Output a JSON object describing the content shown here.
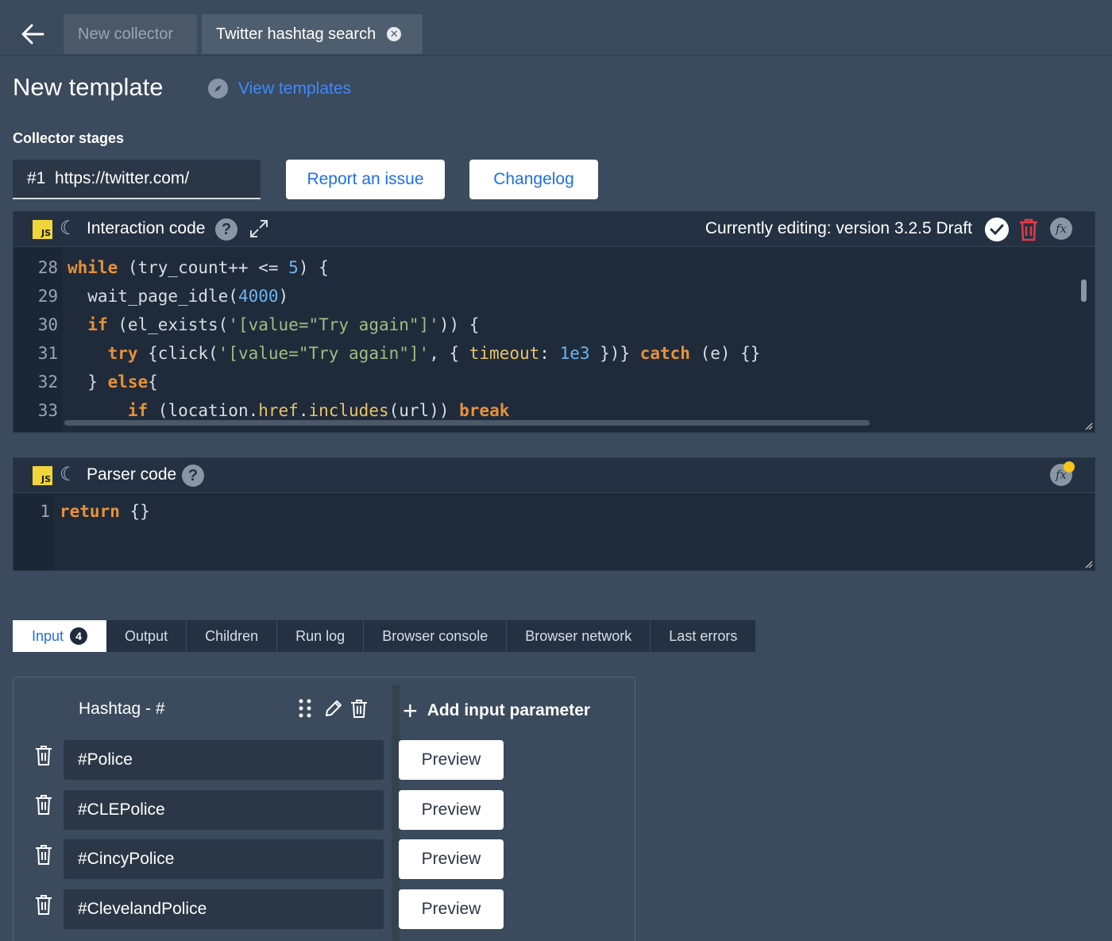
{
  "tabs": {
    "new_collector": "New collector",
    "active": "Twitter hashtag search"
  },
  "header": {
    "title": "New template",
    "view_templates": "View templates"
  },
  "stages": {
    "label": "Collector stages",
    "selected": "#1  https://twitter.com/",
    "report_issue": "Report an issue",
    "changelog": "Changelog"
  },
  "interaction": {
    "title": "Interaction code",
    "editing": "Currently editing: version 3.2.5 Draft",
    "lines": [
      {
        "n": "28",
        "code": "while (try_count++ <= 5) {"
      },
      {
        "n": "29",
        "code": "  wait_page_idle(4000)"
      },
      {
        "n": "30",
        "code": "  if (el_exists('[value=\"Try again\"]')) {"
      },
      {
        "n": "31",
        "code": "    try {click('[value=\"Try again\"]', { timeout: 1e3 })} catch (e) {}"
      },
      {
        "n": "32",
        "code": "  } else{"
      },
      {
        "n": "33",
        "code": "      if (location.href.includes(url)) break"
      }
    ]
  },
  "parser": {
    "title": "Parser code",
    "lines": [
      {
        "n": "1",
        "code": "return {}"
      }
    ]
  },
  "bottom_tabs": {
    "input": "Input",
    "input_count": "4",
    "output": "Output",
    "children": "Children",
    "run_log": "Run log",
    "browser_console": "Browser console",
    "browser_network": "Browser network",
    "last_errors": "Last errors"
  },
  "input_table": {
    "column": "Hashtag - #",
    "add_param": "Add input parameter",
    "preview_label": "Preview",
    "rows": [
      "#Police",
      "#CLEPolice",
      "#CincyPolice",
      "#ClevelandPolice"
    ]
  },
  "colors": {
    "background": "#3b4a5c",
    "link": "#3d8bff",
    "keyword": "#e8913a",
    "number": "#6fb3f0",
    "string": "#9fbd84",
    "trash_red": "#e23b4a",
    "status_dot": "#f5c518"
  },
  "icons": [
    "back-arrow-icon",
    "close-icon",
    "compass-icon",
    "js-icon",
    "moon-icon",
    "help-icon",
    "expand-icon",
    "check-icon",
    "trash-icon",
    "function-icon",
    "drag-handle-icon",
    "pencil-icon",
    "plus-icon"
  ]
}
